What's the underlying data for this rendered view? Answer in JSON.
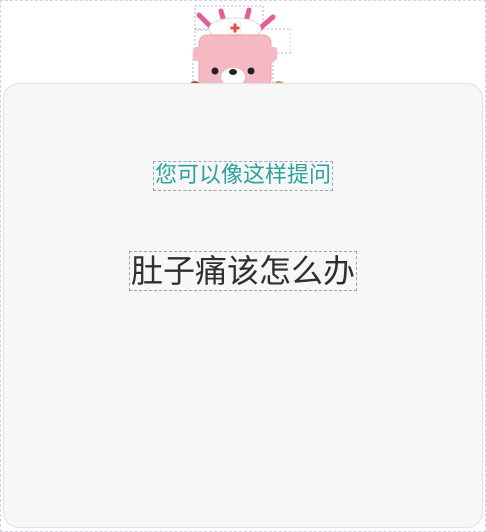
{
  "mascot": {
    "icon": "nurse-bear-mascot-icon"
  },
  "prompt_card": {
    "hint": "您可以像这样提问",
    "example_question": "肚子痛该怎么办"
  },
  "colors": {
    "hint_text": "#2ba39d",
    "question_text": "#2f2f2f",
    "card_background": "#f7f7f7"
  }
}
